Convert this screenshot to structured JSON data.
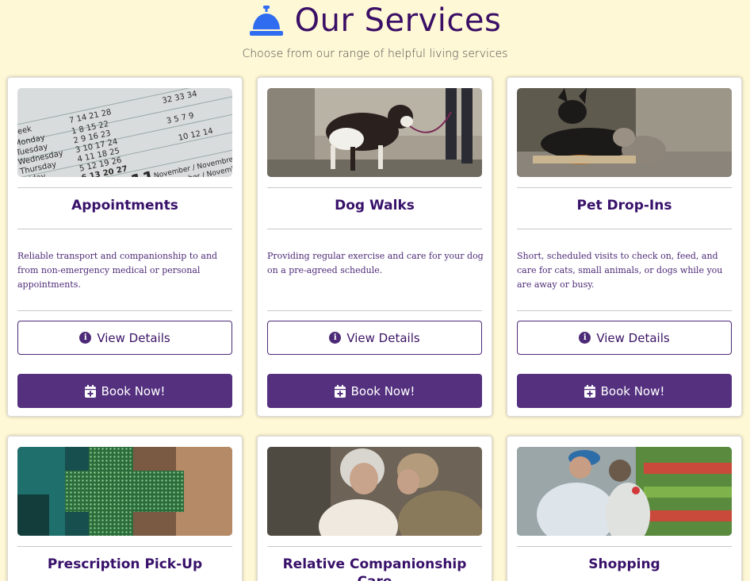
{
  "header": {
    "title": "Our Services",
    "subtitle": "Choose from our range of helpful living services",
    "icon": "concierge-bell-icon"
  },
  "colors": {
    "background": "#fff8d6",
    "title": "#3a0f66",
    "bell": "#2f6cf0",
    "accent": "#54307f"
  },
  "cards": [
    {
      "title": "Appointments",
      "description": "Reliable transport and companionship to and from non-emergency medical or personal appointments.",
      "details_label": "View Details",
      "book_label": "Book Now!",
      "image": "calendar-photo"
    },
    {
      "title": "Dog Walks",
      "description": "Providing regular exercise and care for your dog on a pre-agreed schedule.",
      "details_label": "View Details",
      "book_label": "Book Now!",
      "image": "dog-walk-photo"
    },
    {
      "title": "Pet Drop-Ins",
      "description": "Short, scheduled visits to check on, feed, and care for cats, small animals, or dogs while you are away or busy.",
      "details_label": "View Details",
      "book_label": "Book Now!",
      "image": "dog-and-cat-photo"
    },
    {
      "title": "Prescription Pick-Up",
      "image": "pharmacy-sign-photo"
    },
    {
      "title": "Relative Companionship Care",
      "image": "companionship-photo"
    },
    {
      "title": "Shopping",
      "image": "grocery-shopping-photo"
    }
  ]
}
